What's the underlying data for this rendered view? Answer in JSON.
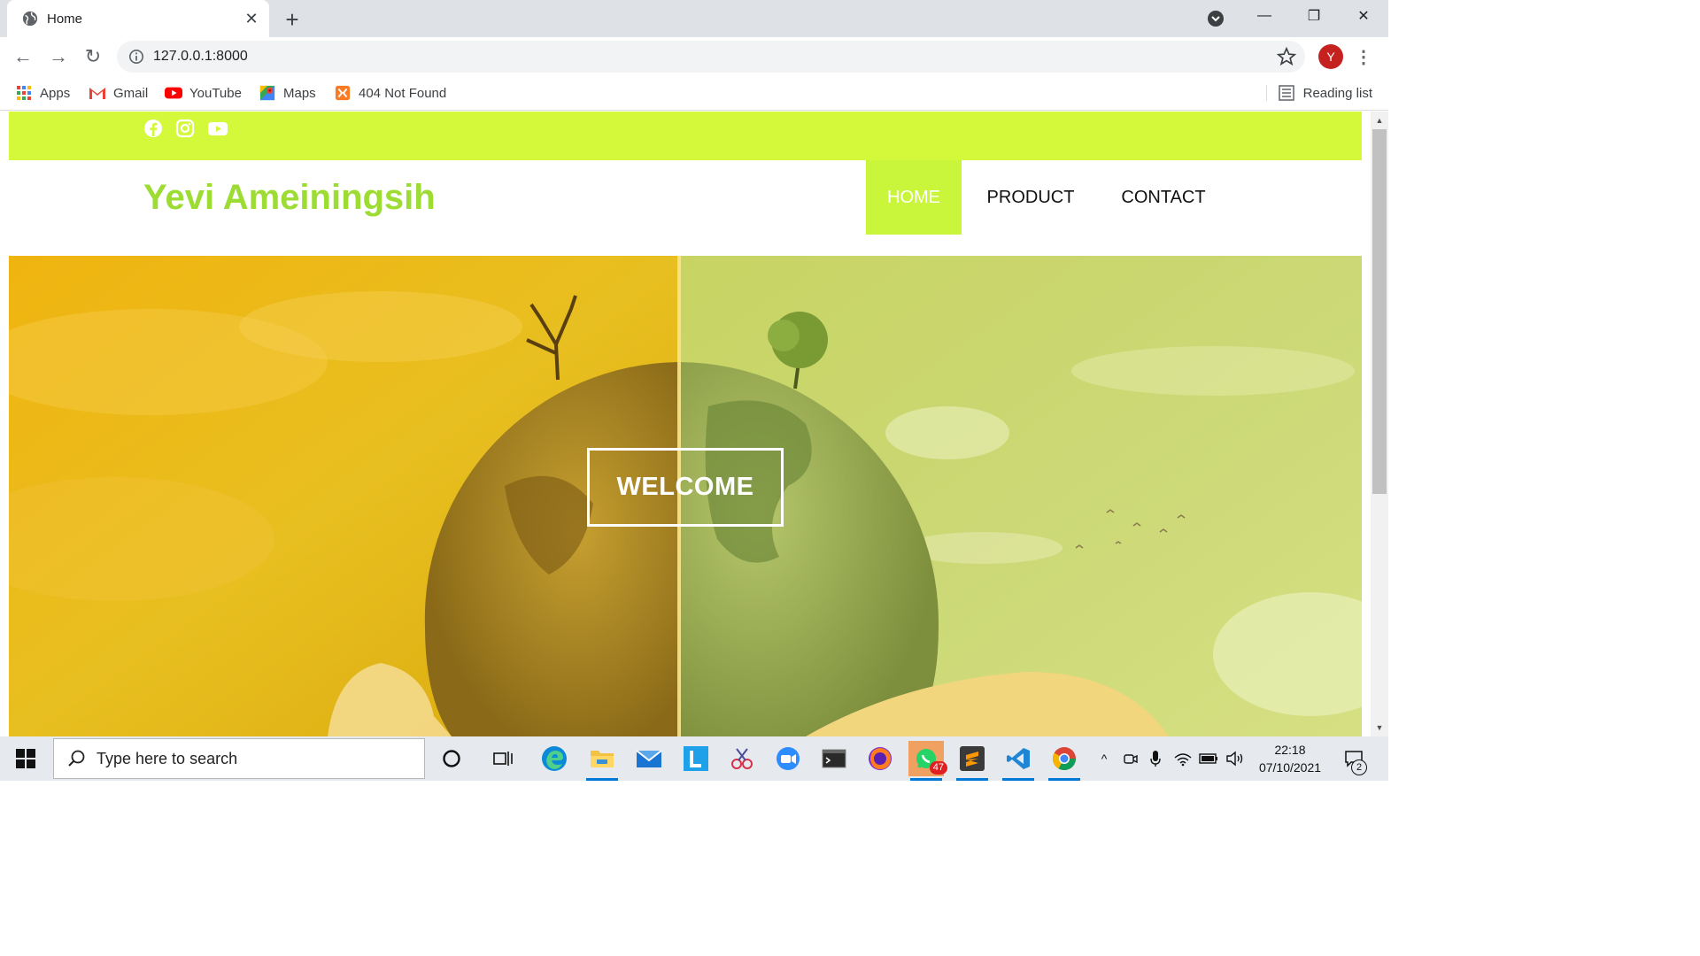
{
  "browser": {
    "tab_title": "Home",
    "url": "127.0.0.1:8000",
    "profile_initial": "Y",
    "bookmarks": [
      {
        "label": "Apps",
        "icon": "apps-grid-icon"
      },
      {
        "label": "Gmail",
        "icon": "gmail-icon"
      },
      {
        "label": "YouTube",
        "icon": "youtube-icon"
      },
      {
        "label": "Maps",
        "icon": "maps-icon"
      },
      {
        "label": "404 Not Found",
        "icon": "xampp-icon"
      }
    ],
    "reading_list": "Reading list"
  },
  "site": {
    "social_icons": [
      "facebook-icon",
      "instagram-icon",
      "youtube-icon"
    ],
    "brand": "Yevi Ameiningsih",
    "nav": [
      {
        "label": "HOME",
        "active": true
      },
      {
        "label": "PRODUCT",
        "active": false
      },
      {
        "label": "CONTACT",
        "active": false
      }
    ],
    "hero_button": "WELCOME",
    "colors": {
      "accent": "#d4f83a",
      "brand_text": "#9cdc33",
      "nav_active": "#c9f53a"
    }
  },
  "taskbar": {
    "search_placeholder": "Type here to search",
    "apps": [
      "cortana-icon",
      "task-view-icon",
      "edge-icon",
      "file-explorer-icon",
      "mail-icon",
      "l-app-icon",
      "snipping-tool-icon",
      "zoom-icon",
      "terminal-icon",
      "firefox-icon",
      "whatsapp-icon",
      "sublime-text-icon",
      "vscode-icon",
      "chrome-icon"
    ],
    "whatsapp_badge": "47",
    "time": "22:18",
    "date": "07/10/2021",
    "notification_count": "2"
  }
}
